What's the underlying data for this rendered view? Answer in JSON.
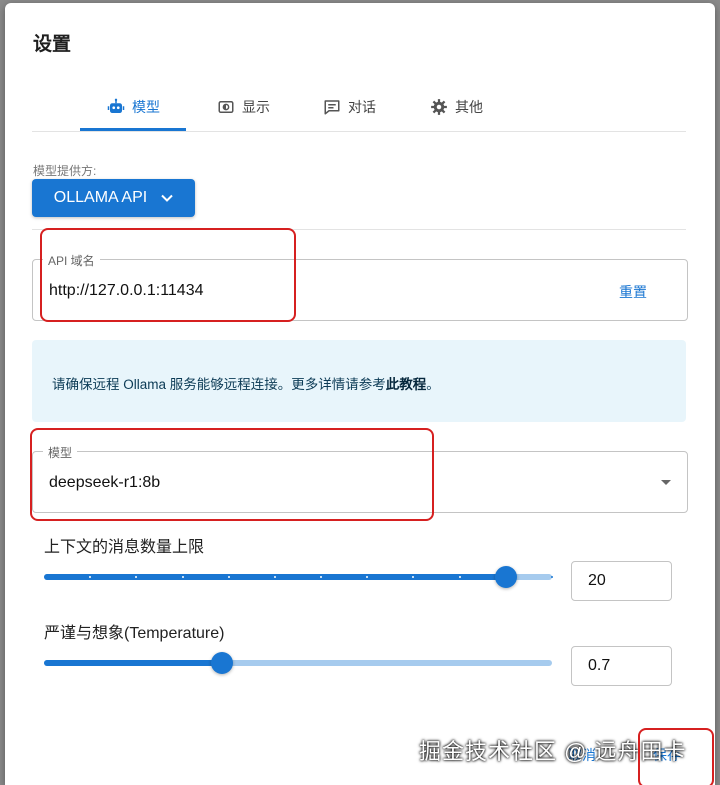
{
  "dialog": {
    "title": "设置"
  },
  "tabs": [
    {
      "label": "模型",
      "icon": "robot-icon",
      "active": true
    },
    {
      "label": "显示",
      "icon": "display-icon",
      "active": false
    },
    {
      "label": "对话",
      "icon": "chat-icon",
      "active": false
    },
    {
      "label": "其他",
      "icon": "gear-icon",
      "active": false
    }
  ],
  "provider": {
    "label": "模型提供方:",
    "value": "OLLAMA API"
  },
  "api_host": {
    "legend": "API 域名",
    "value": "http://127.0.0.1:11434",
    "reset_label": "重置"
  },
  "info": {
    "text_prefix": "请确保远程 Ollama 服务能够远程连接。更多详情请参考",
    "link": "此教程",
    "text_suffix": "。"
  },
  "model": {
    "legend": "模型",
    "value": "deepseek-r1:8b"
  },
  "context_limit": {
    "label": "上下文的消息数量上限",
    "value": "20",
    "fraction": 0.91
  },
  "temperature": {
    "label": "严谨与想象(Temperature)",
    "value": "0.7",
    "fraction": 0.35
  },
  "footer": {
    "cancel_label": "取消",
    "save_label": "保存"
  },
  "watermark": "掘金技术社区 @ 远舟田卡",
  "colors": {
    "accent": "#1976d2",
    "accent_light": "#a6cbee",
    "info_bg": "#e8f5fb",
    "annotation": "#d62020"
  }
}
